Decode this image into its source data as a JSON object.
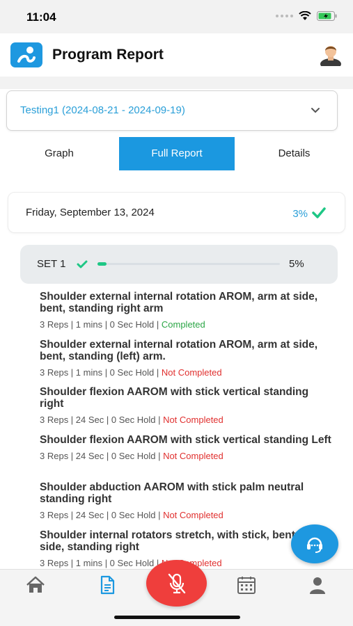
{
  "status_bar": {
    "time": "11:04"
  },
  "header": {
    "title": "Program Report",
    "logo_icon": "app-logo-icon",
    "avatar_icon": "user-avatar-icon"
  },
  "program_select": {
    "value": "Testing1 (2024-08-21 - 2024-09-19)"
  },
  "tabs": [
    {
      "label": "Graph",
      "active": false
    },
    {
      "label": "Full Report",
      "active": true
    },
    {
      "label": "Details",
      "active": false
    }
  ],
  "day": {
    "date": "Friday, September 13, 2024",
    "percent": "3%"
  },
  "set": {
    "label": "SET 1",
    "percent": "5%",
    "progress": 0.05
  },
  "exercises": [
    {
      "title": "Shoulder external internal rotation AROM, arm at side, bent, standing right arm",
      "meta": "3 Reps | 1 mins | 0 Sec Hold | ",
      "status": "Completed",
      "completed": true
    },
    {
      "title": "Shoulder external internal rotation AROM, arm at side, bent, standing (left) arm.",
      "meta": "3 Reps | 1 mins | 0 Sec Hold | ",
      "status": "Not Completed",
      "completed": false
    },
    {
      "title": "Shoulder flexion AAROM with stick vertical standing right",
      "meta": "3 Reps | 24 Sec | 0 Sec Hold | ",
      "status": "Not Completed",
      "completed": false
    },
    {
      "title": "Shoulder flexion AAROM with stick vertical standing Left",
      "meta": "3 Reps | 24 Sec | 0 Sec Hold | ",
      "status": "Not Completed",
      "completed": false
    },
    {
      "title": "Shoulder abduction AAROM with stick palm neutral standing right",
      "meta": "3 Reps | 24 Sec | 0 Sec Hold | ",
      "status": "Not Completed",
      "completed": false
    },
    {
      "title": "Shoulder internal rotators stretch, with stick, bent at side, standing right",
      "meta": "3 Reps | 1 mins | 0 Sec Hold | ",
      "status": "Not Completed",
      "completed": false
    }
  ],
  "colors": {
    "accent": "#1b98e0",
    "completed": "#2ba646",
    "not_completed": "#e0302f",
    "mic": "#ef3e3c",
    "progress": "#1ec785"
  },
  "bottom_nav": [
    "home-icon",
    "report-icon",
    "mic-off-icon",
    "calendar-icon",
    "profile-icon"
  ]
}
